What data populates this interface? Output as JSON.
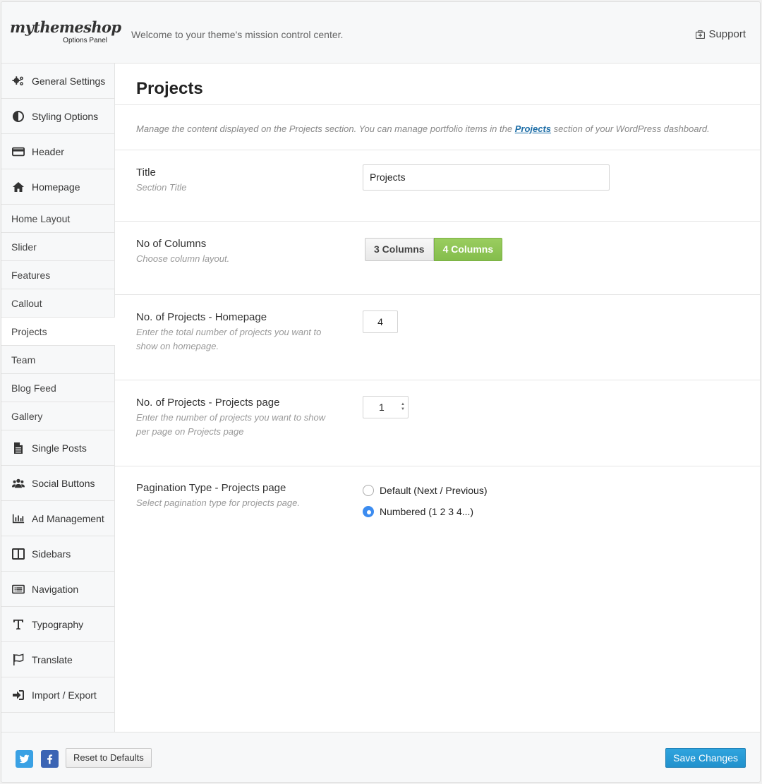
{
  "header": {
    "logo_main": "mythemeshop",
    "logo_sub": "Options Panel",
    "welcome": "Welcome to your theme's mission control center.",
    "support_label": "Support"
  },
  "sidebar": {
    "items": [
      {
        "label": "General Settings",
        "icon": "gears-icon"
      },
      {
        "label": "Styling Options",
        "icon": "contrast-icon"
      },
      {
        "label": "Header",
        "icon": "header-icon"
      },
      {
        "label": "Homepage",
        "icon": "home-icon"
      },
      {
        "label": "Home Layout"
      },
      {
        "label": "Slider"
      },
      {
        "label": "Features"
      },
      {
        "label": "Callout"
      },
      {
        "label": "Projects",
        "active": true
      },
      {
        "label": "Team"
      },
      {
        "label": "Blog Feed"
      },
      {
        "label": "Gallery"
      },
      {
        "label": "Single Posts",
        "icon": "document-icon"
      },
      {
        "label": "Social Buttons",
        "icon": "users-icon"
      },
      {
        "label": "Ad Management",
        "icon": "bar-chart-icon"
      },
      {
        "label": "Sidebars",
        "icon": "columns-icon"
      },
      {
        "label": "Navigation",
        "icon": "list-icon"
      },
      {
        "label": "Typography",
        "icon": "text-icon"
      },
      {
        "label": "Translate",
        "icon": "flag-icon"
      },
      {
        "label": "Import / Export",
        "icon": "sign-in-icon"
      }
    ]
  },
  "main": {
    "title": "Projects",
    "description_before": "Manage the content displayed on the Projects section. You can manage portfolio items in the ",
    "description_link": "Projects",
    "description_after": " section of your WordPress dashboard.",
    "fields": {
      "title": {
        "label": "Title",
        "sublabel": "Section Title",
        "value": "Projects"
      },
      "columns": {
        "label": "No of Columns",
        "sublabel": "Choose column layout.",
        "options": [
          "3 Columns",
          "4 Columns"
        ],
        "selected": "4 Columns"
      },
      "homepage_count": {
        "label": "No. of Projects - Homepage",
        "sublabel": "Enter the total number of projects you want to show on homepage.",
        "value": "4"
      },
      "page_count": {
        "label": "No. of Projects - Projects page",
        "sublabel": "Enter the number of projects you want to show per page on Projects page",
        "value": "1"
      },
      "pagination": {
        "label": "Pagination Type - Projects page",
        "sublabel": "Select pagination type for projects page.",
        "options": [
          "Default (Next / Previous)",
          "Numbered (1 2 3 4...)"
        ],
        "selected": "Numbered (1 2 3 4...)"
      }
    }
  },
  "footer": {
    "reset_label": "Reset to Defaults",
    "save_label": "Save Changes"
  },
  "colors": {
    "accent_green": "#8bc34a",
    "save_blue": "#2191cd",
    "radio_blue": "#3c8cf0",
    "link_blue": "#1e6ea7"
  }
}
